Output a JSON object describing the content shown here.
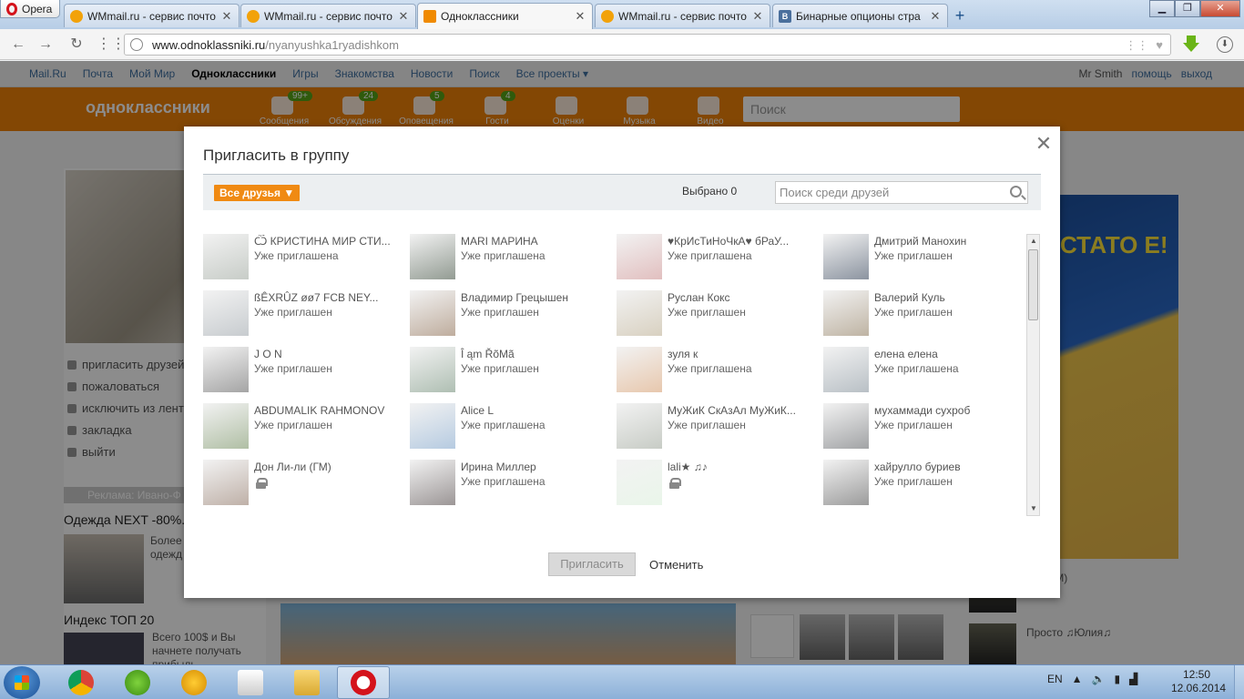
{
  "browser": {
    "menu_label": "Opera",
    "tabs": [
      {
        "title": "WMmail.ru - сервис почто",
        "favicon": "wmmail-icon",
        "active": false
      },
      {
        "title": "WMmail.ru - сервис почто",
        "favicon": "wmmail-icon",
        "active": false
      },
      {
        "title": "Одноклассники",
        "favicon": "ok-icon",
        "active": true
      },
      {
        "title": "WMmail.ru - сервис почто",
        "favicon": "wmmail-icon",
        "active": false
      },
      {
        "title": "Бинарные опционы стра",
        "favicon": "vk-icon",
        "active": false
      }
    ],
    "url_domain": "www.odnoklassniki.ru",
    "url_path": "/nyanyushka1ryadishkom"
  },
  "portal_nav": {
    "links": [
      "Mail.Ru",
      "Почта",
      "Мой Мир",
      "Одноклассники",
      "Игры",
      "Знакомства",
      "Новости",
      "Поиск",
      "Все проекты ▾"
    ],
    "current": "Одноклассники",
    "user": "Mr Smith",
    "help": "помощь",
    "logout": "выход"
  },
  "ok_header": {
    "logo": "одноклассники",
    "icons": [
      {
        "label": "Сообщения",
        "count": "99+"
      },
      {
        "label": "Обсуждения",
        "count": "24"
      },
      {
        "label": "Оповещения",
        "count": "5"
      },
      {
        "label": "Гости",
        "count": "4"
      },
      {
        "label": "Оценки",
        "count": ""
      },
      {
        "label": "Музыка",
        "count": ""
      },
      {
        "label": "Видео",
        "count": ""
      }
    ],
    "search_placeholder": "Поиск"
  },
  "left_menu": [
    "пригласить друзей",
    "пожаловаться",
    "исключить из ленты",
    "закладка",
    "выйти"
  ],
  "ads": {
    "label": "Реклама: Ивано-Ф",
    "item1_title": "Одежда NEXT -80%...",
    "item1_text": "Более брендо мужск одежд скидко",
    "item2_title": "Индекс ТОП 20",
    "item2_text": "Всего 100$ и Вы начнете получать прибыль"
  },
  "right_side": {
    "banner_text": "СТАТО Е!",
    "name1": "-ли (ГМ)",
    "name2": "Просто ♫Юлия♫"
  },
  "modal": {
    "title": "Пригласить в группу",
    "filter_label": "Все друзья ▼",
    "selected_label": "Выбрано 0",
    "search_placeholder": "Поиск среди друзей",
    "invite_button": "Пригласить",
    "cancel_button": "Отменить",
    "friends": [
      {
        "name": "Ѽ КРИСТИНА МИР СТИ...",
        "status": "Уже приглашена",
        "locked": false,
        "color": "#9aa39a"
      },
      {
        "name": "MARI МАРИНА",
        "status": "Уже приглашена",
        "locked": false,
        "color": "#3a4a3a"
      },
      {
        "name": "♥КрИсТиНоЧкА♥ бРаУ...",
        "status": "Уже приглашена",
        "locked": false,
        "color": "#c98b8b"
      },
      {
        "name": "Дмитрий Манохин",
        "status": "Уже приглашен",
        "locked": false,
        "color": "#2d3c52"
      },
      {
        "name": "ßÊXRÛZ øø7 FCB NEY...",
        "status": "Уже приглашен",
        "locked": false,
        "color": "#9aa2a8"
      },
      {
        "name": "Владимир Грецышен",
        "status": "Уже приглашен",
        "locked": false,
        "color": "#8a6a4e"
      },
      {
        "name": "Руслан Кокс",
        "status": "Уже приглашен",
        "locked": false,
        "color": "#b9ab8e"
      },
      {
        "name": "Валерий Куль",
        "status": "Уже приглашен",
        "locked": false,
        "color": "#8a7658"
      },
      {
        "name": "J O N",
        "status": "Уже приглашен",
        "locked": false,
        "color": "#5a5a5a"
      },
      {
        "name": "Î ąm ŘõMã",
        "status": "Уже приглашен",
        "locked": false,
        "color": "#6d8a74"
      },
      {
        "name": "зуля к",
        "status": "Уже приглашена",
        "locked": false,
        "color": "#d49a6a"
      },
      {
        "name": "елена елена",
        "status": "Уже приглашена",
        "locked": false,
        "color": "#7f8c96"
      },
      {
        "name": "ABDUMALIK RAHMONOV",
        "status": "Уже приглашен",
        "locked": false,
        "color": "#6f8a5a"
      },
      {
        "name": "Alice L",
        "status": "Уже приглашена",
        "locked": false,
        "color": "#7aa0c8"
      },
      {
        "name": "МуЖиК СкАзАл МуЖиК...",
        "status": "Уже приглашен",
        "locked": false,
        "color": "#9aa296"
      },
      {
        "name": "мухаммади сухроб",
        "status": "Уже приглашен",
        "locked": false,
        "color": "#55585c"
      },
      {
        "name": "Дон Ли-ли (ГМ)",
        "status": "",
        "locked": true,
        "color": "#8a7060"
      },
      {
        "name": "Ирина Миллер",
        "status": "Уже приглашена",
        "locked": false,
        "color": "#4a4040"
      },
      {
        "name": "lali★ ♫♪",
        "status": "",
        "locked": true,
        "color": "#d8eed8"
      },
      {
        "name": "хайрулло буриев",
        "status": "Уже приглашен",
        "locked": false,
        "color": "#4a4a4a"
      }
    ]
  },
  "taskbar": {
    "apps": [
      "chrome-icon",
      "utorrent-icon",
      "aimp-icon",
      "solitaire-icon",
      "explorer-icon",
      "opera-icon"
    ],
    "lang": "EN",
    "time": "12:50",
    "date": "12.06.2014"
  }
}
